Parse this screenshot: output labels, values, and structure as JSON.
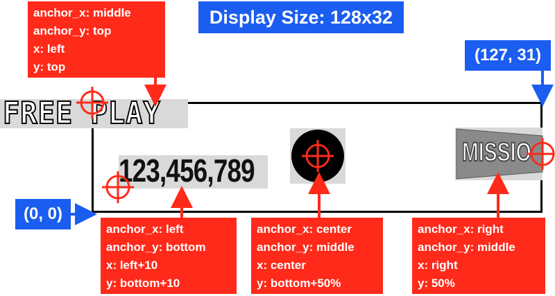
{
  "display_size_label": "Display Size: 128x32",
  "top_right_coord": "(127, 31)",
  "origin_coord": "(0, 0)",
  "samples": {
    "freeplay_text": "FREE PLAY",
    "number_text": "123,456,789",
    "mission_text": "MISSIO"
  },
  "callouts": {
    "top_left": [
      "anchor_x: middle",
      "anchor_y: top",
      "x: left",
      "y: top"
    ],
    "bottom_left": [
      "anchor_x: left",
      "anchor_y: bottom",
      "x: left+10",
      "y: bottom+10"
    ],
    "bottom_middle": [
      "anchor_x: center",
      "anchor_y: middle",
      "x: center",
      "y: bottom+50%"
    ],
    "bottom_right": [
      "anchor_x: right",
      "anchor_y: middle",
      "x: right",
      "y: 50%"
    ]
  },
  "colors": {
    "callout_red": "#ff2a1a",
    "coord_blue": "#1a5df0",
    "target_red": "#ff2a1a"
  }
}
